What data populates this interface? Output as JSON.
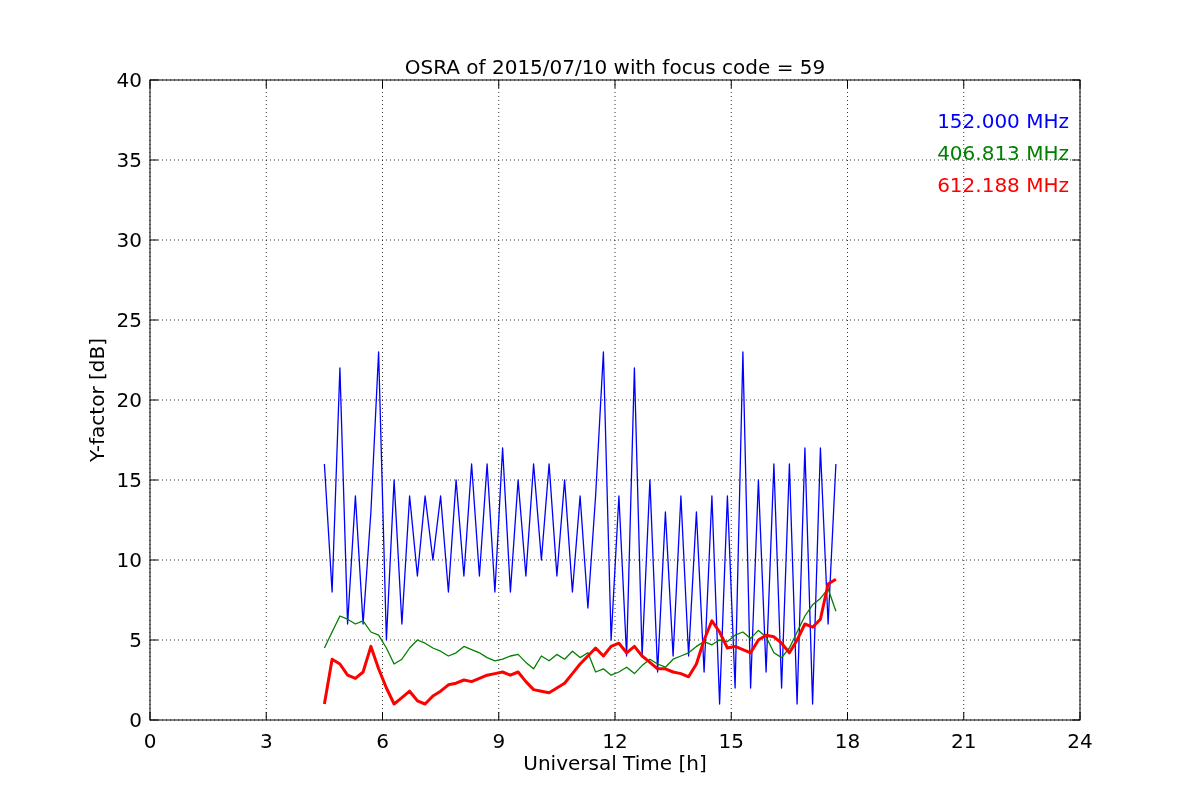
{
  "chart_data": {
    "type": "line",
    "title": "OSRA of 2015/07/10 with focus code = 59",
    "xlabel": "Universal Time [h]",
    "ylabel": "Y-factor [dB]",
    "x": [
      4.5,
      4.7,
      4.9,
      5.1,
      5.3,
      5.5,
      5.7,
      5.9,
      6.1,
      6.3,
      6.5,
      6.7,
      6.9,
      7.1,
      7.3,
      7.5,
      7.7,
      7.9,
      8.1,
      8.3,
      8.5,
      8.7,
      8.9,
      9.1,
      9.3,
      9.5,
      9.7,
      9.9,
      10.1,
      10.3,
      10.5,
      10.7,
      10.9,
      11.1,
      11.3,
      11.5,
      11.7,
      11.9,
      12.1,
      12.3,
      12.5,
      12.7,
      12.9,
      13.1,
      13.3,
      13.5,
      13.7,
      13.9,
      14.1,
      14.3,
      14.5,
      14.7,
      14.9,
      15.1,
      15.3,
      15.5,
      15.7,
      15.9,
      16.1,
      16.3,
      16.5,
      16.7,
      16.9,
      17.1,
      17.3,
      17.5,
      17.7
    ],
    "series": [
      {
        "name": "152.000 MHz",
        "color": "#0000ff",
        "values": [
          16,
          8,
          22,
          6,
          14,
          6,
          13,
          23,
          5,
          15,
          6,
          14,
          9,
          14,
          10,
          14,
          8,
          15,
          9,
          16,
          9,
          16,
          8,
          17,
          8,
          15,
          9,
          16,
          10,
          16,
          9,
          15,
          8,
          14,
          7,
          14,
          23,
          5,
          14,
          4,
          22,
          4,
          15,
          3,
          13,
          4,
          14,
          4,
          13,
          3,
          14,
          1,
          14,
          2,
          23,
          2,
          15,
          3,
          16,
          2,
          16,
          1,
          17,
          1,
          17,
          6,
          16
        ]
      },
      {
        "name": "406.813 MHz",
        "color": "#008000",
        "values": [
          4.5,
          5.5,
          6.5,
          6.3,
          6.0,
          6.2,
          5.5,
          5.3,
          4.5,
          3.5,
          3.8,
          4.5,
          5.0,
          4.8,
          4.5,
          4.3,
          4.0,
          4.2,
          4.6,
          4.4,
          4.2,
          3.9,
          3.7,
          3.8,
          4.0,
          4.1,
          3.6,
          3.2,
          4.0,
          3.7,
          4.1,
          3.8,
          4.3,
          3.9,
          4.2,
          3.0,
          3.2,
          2.8,
          3.0,
          3.3,
          2.9,
          3.4,
          3.8,
          3.5,
          3.3,
          3.8,
          4.0,
          4.2,
          4.6,
          4.9,
          4.7,
          5.0,
          4.9,
          5.3,
          5.5,
          5.1,
          5.6,
          5.2,
          4.2,
          3.9,
          4.5,
          5.5,
          6.5,
          7.2,
          7.6,
          8.2,
          6.8
        ]
      },
      {
        "name": "612.188 MHz",
        "color": "#ff0000",
        "values": [
          1.0,
          3.8,
          3.5,
          2.8,
          2.6,
          3.0,
          4.6,
          3.2,
          2.0,
          1.0,
          1.4,
          1.8,
          1.2,
          1.0,
          1.5,
          1.8,
          2.2,
          2.3,
          2.5,
          2.4,
          2.6,
          2.8,
          2.9,
          3.0,
          2.8,
          3.0,
          2.4,
          1.9,
          1.8,
          1.7,
          2.0,
          2.3,
          2.9,
          3.5,
          4.0,
          4.5,
          4.0,
          4.6,
          4.8,
          4.2,
          4.6,
          4.0,
          3.6,
          3.2,
          3.2,
          3.0,
          2.9,
          2.7,
          3.5,
          5.0,
          6.2,
          5.5,
          4.5,
          4.6,
          4.4,
          4.2,
          5.0,
          5.3,
          5.2,
          4.8,
          4.2,
          5.0,
          6.0,
          5.8,
          6.3,
          8.5,
          8.8
        ]
      }
    ],
    "grid": true,
    "xlim": [
      0,
      24
    ],
    "ylim": [
      0,
      40
    ],
    "xticks": [
      0,
      3,
      6,
      9,
      12,
      15,
      18,
      21,
      24
    ],
    "yticks": [
      0,
      5,
      10,
      15,
      20,
      25,
      30,
      35,
      40
    ]
  }
}
